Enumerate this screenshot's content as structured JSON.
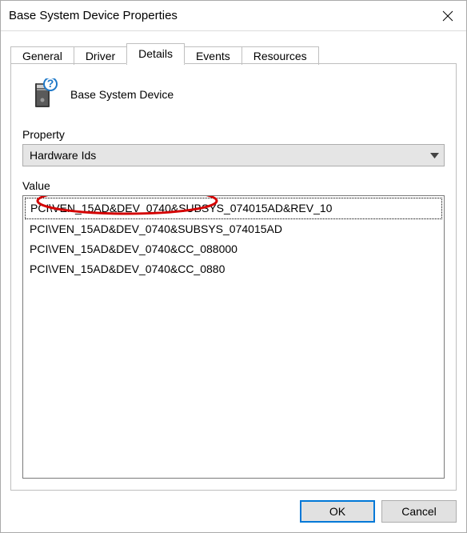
{
  "window": {
    "title": "Base System Device Properties"
  },
  "tabs": [
    {
      "label": "General"
    },
    {
      "label": "Driver"
    },
    {
      "label": "Details"
    },
    {
      "label": "Events"
    },
    {
      "label": "Resources"
    }
  ],
  "active_tab_index": 2,
  "device": {
    "name": "Base System Device"
  },
  "property": {
    "label": "Property",
    "selected": "Hardware Ids"
  },
  "value": {
    "label": "Value",
    "items": [
      "PCI\\VEN_15AD&DEV_0740&SUBSYS_074015AD&REV_10",
      "PCI\\VEN_15AD&DEV_0740&SUBSYS_074015AD",
      "PCI\\VEN_15AD&DEV_0740&CC_088000",
      "PCI\\VEN_15AD&DEV_0740&CC_0880"
    ],
    "selected_index": 0
  },
  "buttons": {
    "ok": "OK",
    "cancel": "Cancel"
  }
}
